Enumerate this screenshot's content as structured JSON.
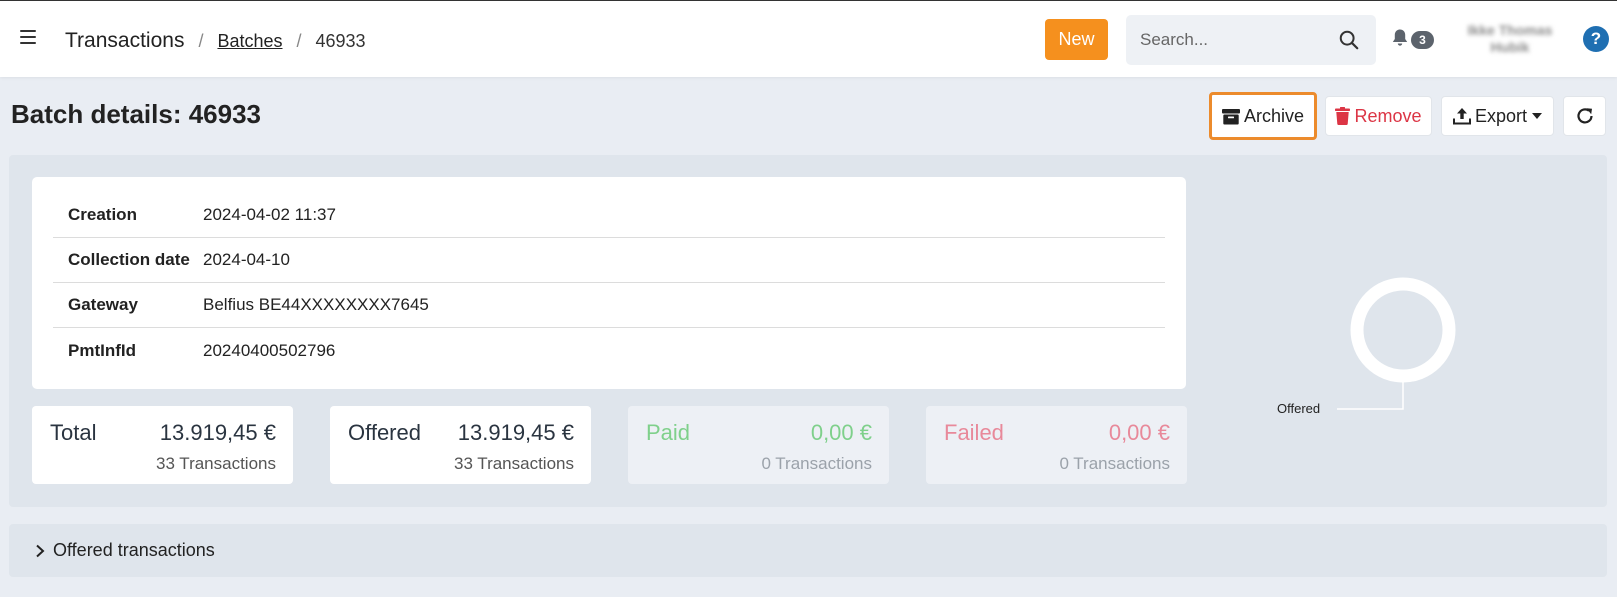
{
  "navbar": {
    "breadcrumb": {
      "root": "Transactions",
      "link": "Batches",
      "current": "46933",
      "separator": "/"
    },
    "new_label": "New",
    "search_placeholder": "Search...",
    "notifications_count": "3",
    "user_name_line1": "Ikke Thomas",
    "user_name_line2": "Hubik",
    "help_label": "?"
  },
  "page": {
    "title": "Batch details: 46933"
  },
  "toolbar": {
    "archive_label": "Archive",
    "remove_label": "Remove",
    "export_label": "Export"
  },
  "details": [
    {
      "label": "Creation",
      "value": "2024-04-02 11:37"
    },
    {
      "label": "Collection date",
      "value": "2024-04-10"
    },
    {
      "label": "Gateway",
      "value": "Belfius BE44XXXXXXXX7645"
    },
    {
      "label": "PmtInfId",
      "value": "20240400502796"
    }
  ],
  "stats": [
    {
      "label": "Total",
      "amount": "13.919,45 €",
      "sub": "33 Transactions"
    },
    {
      "label": "Offered",
      "amount": "13.919,45 €",
      "sub": "33 Transactions"
    },
    {
      "label": "Paid",
      "amount": "0,00 €",
      "sub": "0 Transactions"
    },
    {
      "label": "Failed",
      "amount": "0,00 €",
      "sub": "0 Transactions"
    }
  ],
  "donut": {
    "label": "Offered",
    "offered_fraction": 1.0
  },
  "collapse": {
    "title": "Offered transactions"
  },
  "colors": {
    "accent": "#f5901e",
    "archive_focus": "#ec8b2c",
    "remove": "#dc3545",
    "paid": "#7fd08b",
    "failed": "#e8899a",
    "help": "#1f6fb2"
  },
  "icons": [
    "menu-icon",
    "search-icon",
    "bell-icon",
    "help-icon",
    "archive-icon",
    "trash-icon",
    "upload-icon",
    "refresh-icon",
    "chevron-right-icon"
  ]
}
